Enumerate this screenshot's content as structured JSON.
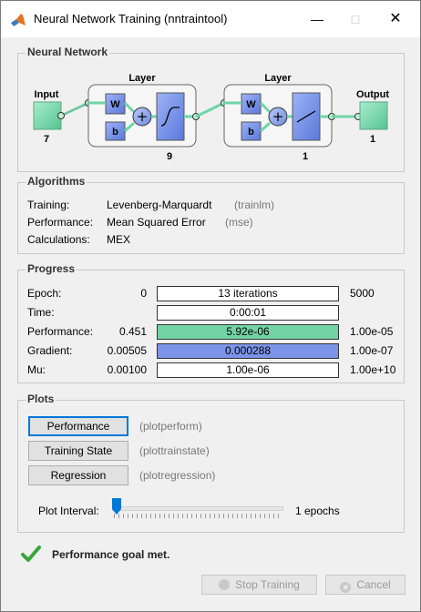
{
  "window": {
    "title": "Neural Network Training (nntraintool)",
    "minimize_icon": "minimize-icon",
    "maximize_icon": "maximize-icon",
    "close_icon": "close-icon"
  },
  "network": {
    "section_title": "Neural Network",
    "input_label": "Input",
    "input_size": "7",
    "output_label": "Output",
    "output_size": "1",
    "layers": [
      {
        "title": "Layer",
        "weight": "W",
        "bias": "b",
        "size": "9",
        "transfer": "tansig"
      },
      {
        "title": "Layer",
        "weight": "W",
        "bias": "b",
        "size": "1",
        "transfer": "purelin"
      }
    ]
  },
  "algorithms": {
    "section_title": "Algorithms",
    "rows": [
      {
        "label": "Training:",
        "value": "Levenberg-Marquardt",
        "fn": "(trainlm)"
      },
      {
        "label": "Performance:",
        "value": "Mean Squared Error",
        "fn": "(mse)"
      },
      {
        "label": "Calculations:",
        "value": "MEX",
        "fn": ""
      }
    ]
  },
  "progress": {
    "section_title": "Progress",
    "rows": [
      {
        "label": "Epoch:",
        "start": "0",
        "current": "13 iterations",
        "end": "5000",
        "fill_color": "",
        "fill_fraction": 0
      },
      {
        "label": "Time:",
        "start": "",
        "current": "0:00:01",
        "end": "",
        "fill_color": "",
        "fill_fraction": 0
      },
      {
        "label": "Performance:",
        "start": "0.451",
        "current": "5.92e-06",
        "end": "1.00e-05",
        "fill_color": "#73d3a4",
        "fill_fraction": 1.0
      },
      {
        "label": "Gradient:",
        "start": "0.00505",
        "current": "0.000288",
        "end": "1.00e-07",
        "fill_color": "#7b93e8",
        "fill_fraction": 1.0
      },
      {
        "label": "Mu:",
        "start": "0.00100",
        "current": "1.00e-06",
        "end": "1.00e+10",
        "fill_color": "",
        "fill_fraction": 0
      }
    ]
  },
  "plots": {
    "section_title": "Plots",
    "buttons": [
      {
        "label": "Performance",
        "fn": "(plotperform)"
      },
      {
        "label": "Training State",
        "fn": "(plottrainstate)"
      },
      {
        "label": "Regression",
        "fn": "(plotregression)"
      }
    ],
    "interval_label": "Plot Interval:",
    "interval_value": "1 epochs",
    "interval_slider_fraction": 0
  },
  "status": {
    "icon": "checkmark-icon",
    "message": "Performance goal met.",
    "color": "#3aa63a"
  },
  "footer": {
    "stop_label": "Stop Training",
    "cancel_label": "Cancel"
  }
}
